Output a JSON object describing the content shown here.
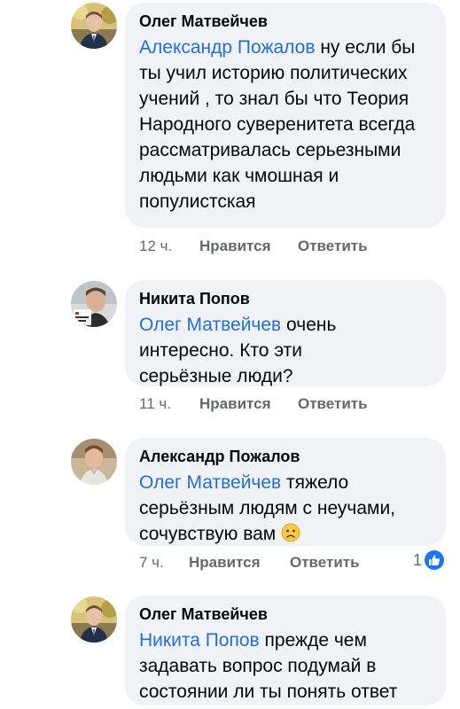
{
  "comments": [
    {
      "author": "Олег Матвейчев",
      "mention": "Александр Пожалов",
      "text": " ну если бы ты учил историю политических учений , то знал бы что Теория Народного суверенитета всегда рассматривалась серьезными людьми как  чмошная и популистская",
      "time": "12 ч.",
      "like": "Нравится",
      "reply": "Ответить"
    },
    {
      "author": "Никита Попов",
      "mention": "Олег Матвейчев",
      "text": " очень интересно. Кто эти серьёзные люди?",
      "time": "11 ч.",
      "like": "Нравится",
      "reply": "Ответить"
    },
    {
      "author": "Александр Пожалов",
      "mention": "Олег Матвейчев",
      "text": " тяжело серьёзным людям с неучами, сочувствую вам ",
      "emoji": "frowning-face-emoji",
      "time": "7 ч.",
      "like": "Нравится",
      "reply": "Ответить",
      "reaction_count": "1",
      "reaction_icon": "like-icon"
    },
    {
      "author": "Олег Матвейчев",
      "mention": "Никита Попов",
      "text": " прежде чем задавать  вопрос  подумай в состоянии ли ты понять ответ"
    }
  ],
  "colors": {
    "bubble": "#f0f2f5",
    "mention": "#216fdb",
    "meta": "#65676b",
    "like_blue": "#1877f2"
  }
}
